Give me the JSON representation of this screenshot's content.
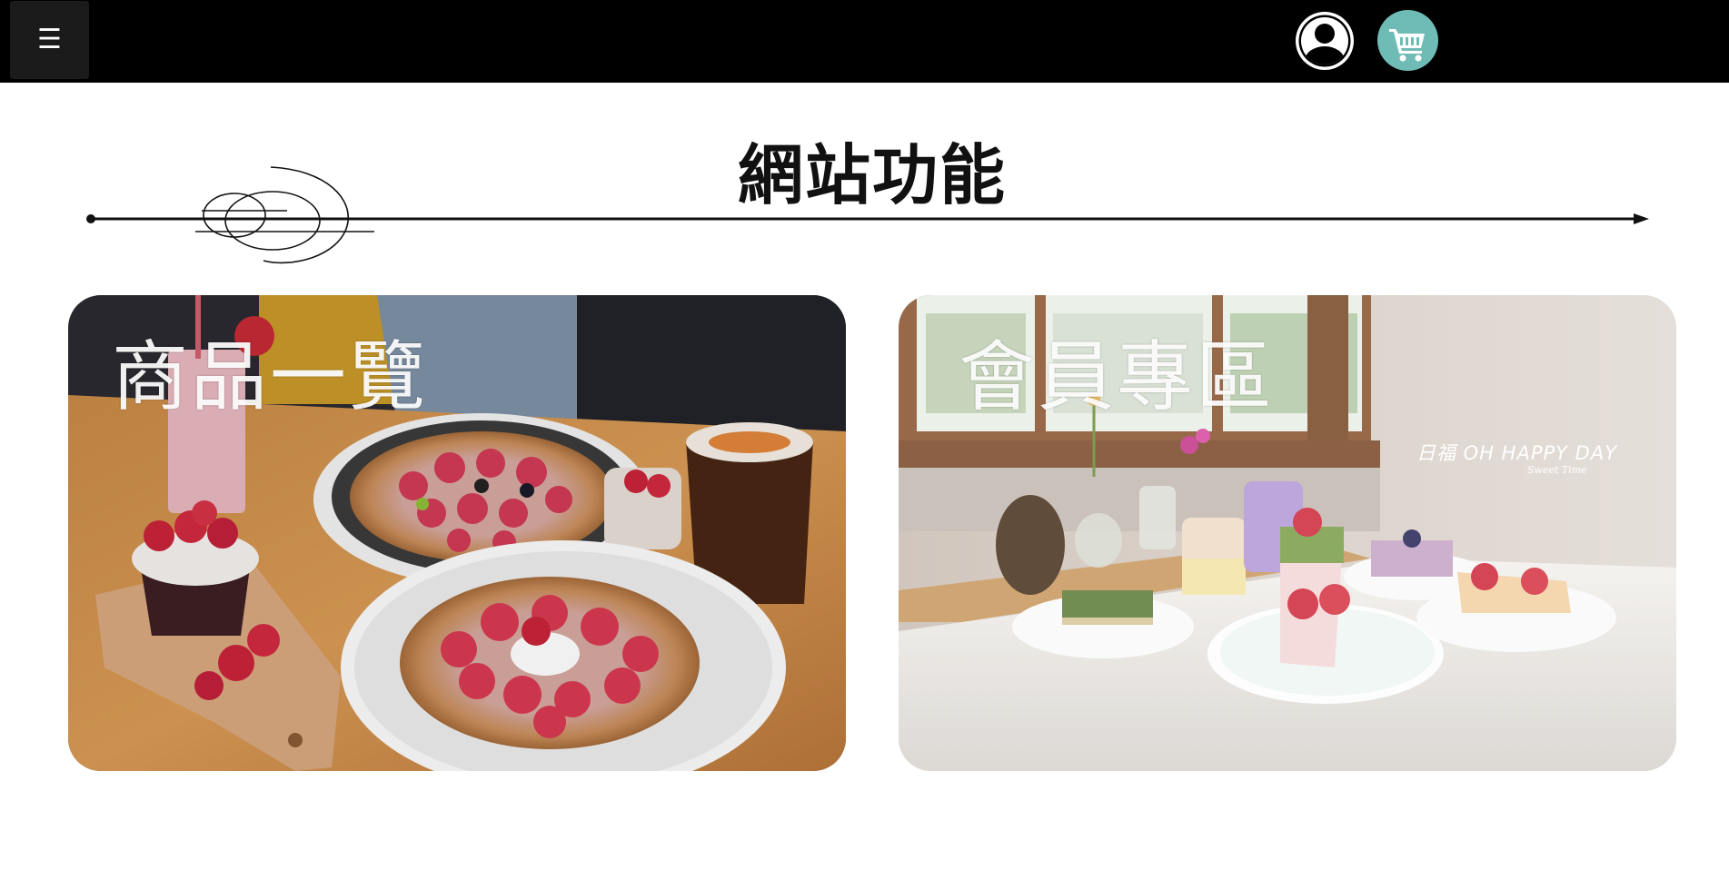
{
  "header": {
    "menu_glyph": "☰",
    "menu_icon": "hamburger-menu-icon",
    "account_icon": "user-account-icon",
    "cart_icon": "shopping-cart-icon",
    "colors": {
      "bar": "#000000",
      "menu_button": "#1b1b1b",
      "cart_accent": "#6fbcb7"
    }
  },
  "section": {
    "title": "網站功能"
  },
  "cards": [
    {
      "label": "商品一覽",
      "image": "strawberry-waffles-and-drinks-photo"
    },
    {
      "label": "會員專區",
      "image": "cakes-on-table-by-window-photo",
      "watermark": "日福 OH HAPPY DAY",
      "watermark_sub": "Sweet Time"
    }
  ]
}
